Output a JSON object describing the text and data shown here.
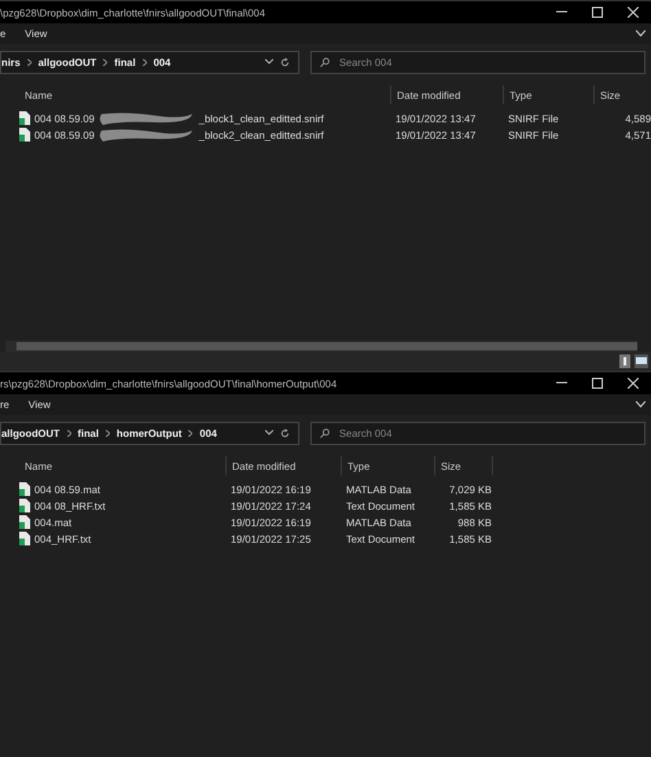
{
  "windows": [
    {
      "title": "\\pzg628\\Dropbox\\dim_charlotte\\fnirs\\allgoodOUT\\final\\004",
      "ribbon": [
        "e",
        "View"
      ],
      "breadcrumb": [
        "nirs",
        "allgoodOUT",
        "final",
        "004"
      ],
      "search": {
        "placeholder": "Search 004"
      },
      "columns": [
        "Name",
        "Date modified",
        "Type",
        "Size"
      ],
      "rows": [
        {
          "name_start": "004 08.59.09",
          "name_end": "_block1_clean_editted.snirf",
          "redacted": true,
          "date": "19/01/2022 13:47",
          "type": "SNIRF File",
          "size": "4,589"
        },
        {
          "name_start": "004 08.59.09",
          "name_end": "_block2_clean_editted.snirf",
          "redacted": true,
          "date": "19/01/2022 13:47",
          "type": "SNIRF File",
          "size": "4,571"
        }
      ],
      "hscroll": true
    },
    {
      "title": "rs\\pzg628\\Dropbox\\dim_charlotte\\fnirs\\allgoodOUT\\final\\homerOutput\\004",
      "ribbon": [
        "re",
        "View"
      ],
      "breadcrumb": [
        "allgoodOUT",
        "final",
        "homerOutput",
        "004"
      ],
      "search": {
        "placeholder": "Search 004"
      },
      "columns": [
        "Name",
        "Date modified",
        "Type",
        "Size"
      ],
      "rows": [
        {
          "name_start": "004 08.59.mat",
          "redacted": false,
          "date": "19/01/2022 16:19",
          "type": "MATLAB Data",
          "size": "7,029 KB"
        },
        {
          "name_start": "004 08_HRF.txt",
          "redacted": false,
          "date": "19/01/2022 17:24",
          "type": "Text Document",
          "size": "1,585 KB"
        },
        {
          "name_start": "004.mat",
          "redacted": false,
          "date": "19/01/2022 16:19",
          "type": "MATLAB Data",
          "size": "988 KB"
        },
        {
          "name_start": "004_HRF.txt",
          "redacted": false,
          "date": "19/01/2022 17:25",
          "type": "Text Document",
          "size": "1,585 KB"
        }
      ],
      "hscroll": false
    }
  ]
}
